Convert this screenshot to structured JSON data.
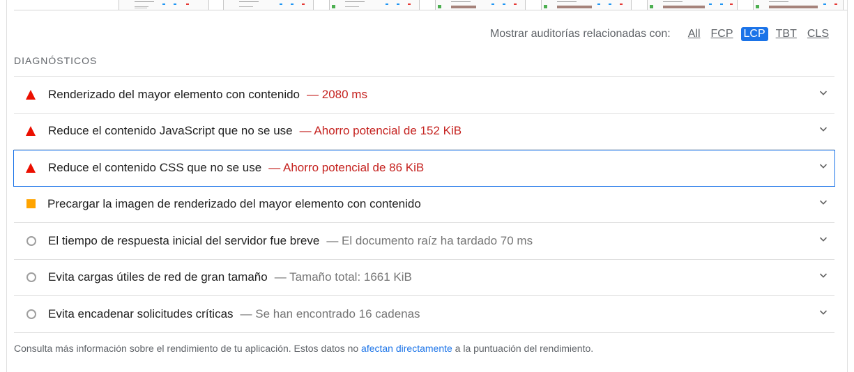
{
  "filter": {
    "label": "Mostrar auditorías relacionadas con:",
    "options": [
      "All",
      "FCP",
      "LCP",
      "TBT",
      "CLS"
    ],
    "active": "LCP"
  },
  "section": {
    "title": "DIAGNÓSTICOS"
  },
  "audits": [
    {
      "status": "fail",
      "icon": "red-triangle-icon",
      "title": "Renderizado del mayor elemento con contenido",
      "detail": "— 2080 ms"
    },
    {
      "status": "fail",
      "icon": "red-triangle-icon",
      "title": "Reduce el contenido JavaScript que no se use",
      "detail": "— Ahorro potencial de 152 KiB"
    },
    {
      "status": "fail",
      "icon": "red-triangle-icon",
      "title": "Reduce el contenido CSS que no se use",
      "detail": "— Ahorro potencial de 86 KiB",
      "focused": true
    },
    {
      "status": "average",
      "icon": "orange-square-icon",
      "title": "Precargar la imagen de renderizado del mayor elemento con contenido",
      "detail": ""
    },
    {
      "status": "info",
      "icon": "gray-circle-icon",
      "title": "El tiempo de respuesta inicial del servidor fue breve",
      "detail": "— El documento raíz ha tardado 70 ms"
    },
    {
      "status": "info",
      "icon": "gray-circle-icon",
      "title": "Evita cargas útiles de red de gran tamaño",
      "detail": "— Tamaño total: 1661 KiB"
    },
    {
      "status": "info",
      "icon": "gray-circle-icon",
      "title": "Evita encadenar solicitudes críticas",
      "detail": "— Se han encontrado 16 cadenas"
    }
  ],
  "footer": {
    "before": "Consulta más información sobre el rendimiento de tu aplicación. Estos datos no ",
    "link": "afectan directamente",
    "after": " a la puntuación del rendimiento."
  },
  "colors": {
    "fail": "#eb0f00",
    "average": "#ffa400",
    "info": "#9e9e9e",
    "accent": "#1a73e8"
  }
}
